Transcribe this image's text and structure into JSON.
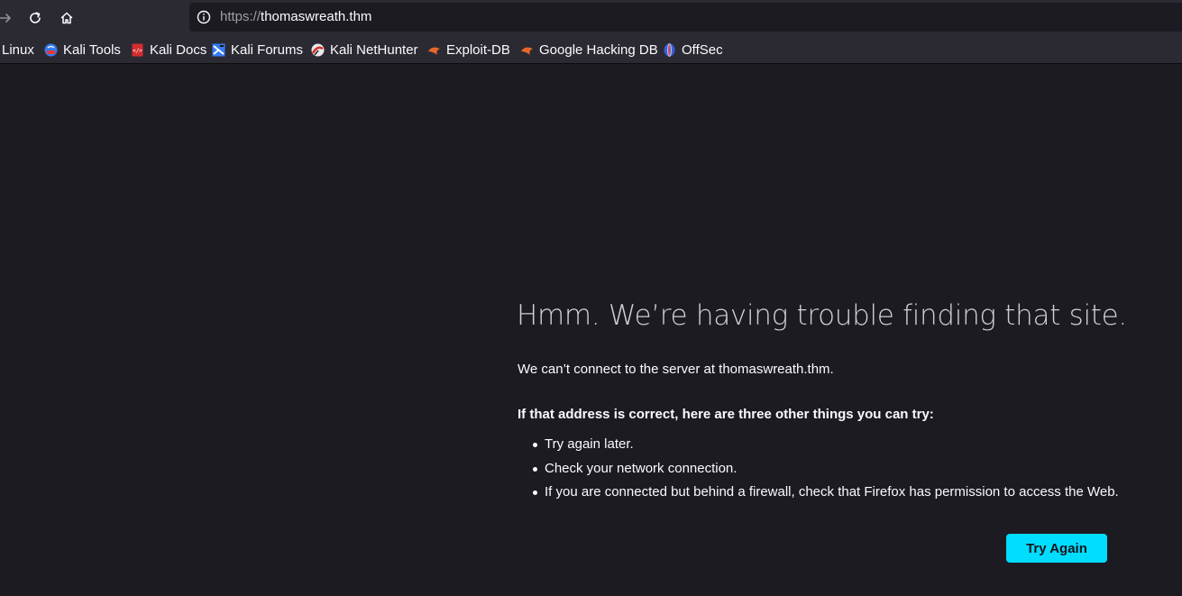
{
  "toolbar": {
    "forward_icon": "arrow-right-icon",
    "reload_icon": "reload-icon",
    "home_icon": "home-icon"
  },
  "urlbar": {
    "scheme": "https://",
    "host": "thomaswreath.thm",
    "info_icon": "info-icon"
  },
  "bookmarks": [
    {
      "label": "Linux",
      "icon": "kali-linux-icon"
    },
    {
      "label": "Kali Tools",
      "icon": "kali-tools-icon"
    },
    {
      "label": "Kali Docs",
      "icon": "kali-docs-icon"
    },
    {
      "label": "Kali Forums",
      "icon": "kali-forums-icon"
    },
    {
      "label": "Kali NetHunter",
      "icon": "kali-nethunter-icon"
    },
    {
      "label": "Exploit-DB",
      "icon": "exploit-db-icon"
    },
    {
      "label": "Google Hacking DB",
      "icon": "ghdb-icon"
    },
    {
      "label": "OffSec",
      "icon": "offsec-icon"
    }
  ],
  "error": {
    "title": "Hmm. We’re having trouble finding that site.",
    "message": "We can’t connect to the server at thomaswreath.thm.",
    "subtitle": "If that address is correct, here are three other things you can try:",
    "suggestions": [
      "Try again later.",
      "Check your network connection.",
      "If you are connected but behind a firewall, check that Firefox has permission to access the Web."
    ],
    "button": "Try Again"
  },
  "colors": {
    "page_bg": "#1c1b22",
    "toolbar_bg": "#2b2a33",
    "accent": "#00ddff",
    "text": "#fbfbfe"
  }
}
